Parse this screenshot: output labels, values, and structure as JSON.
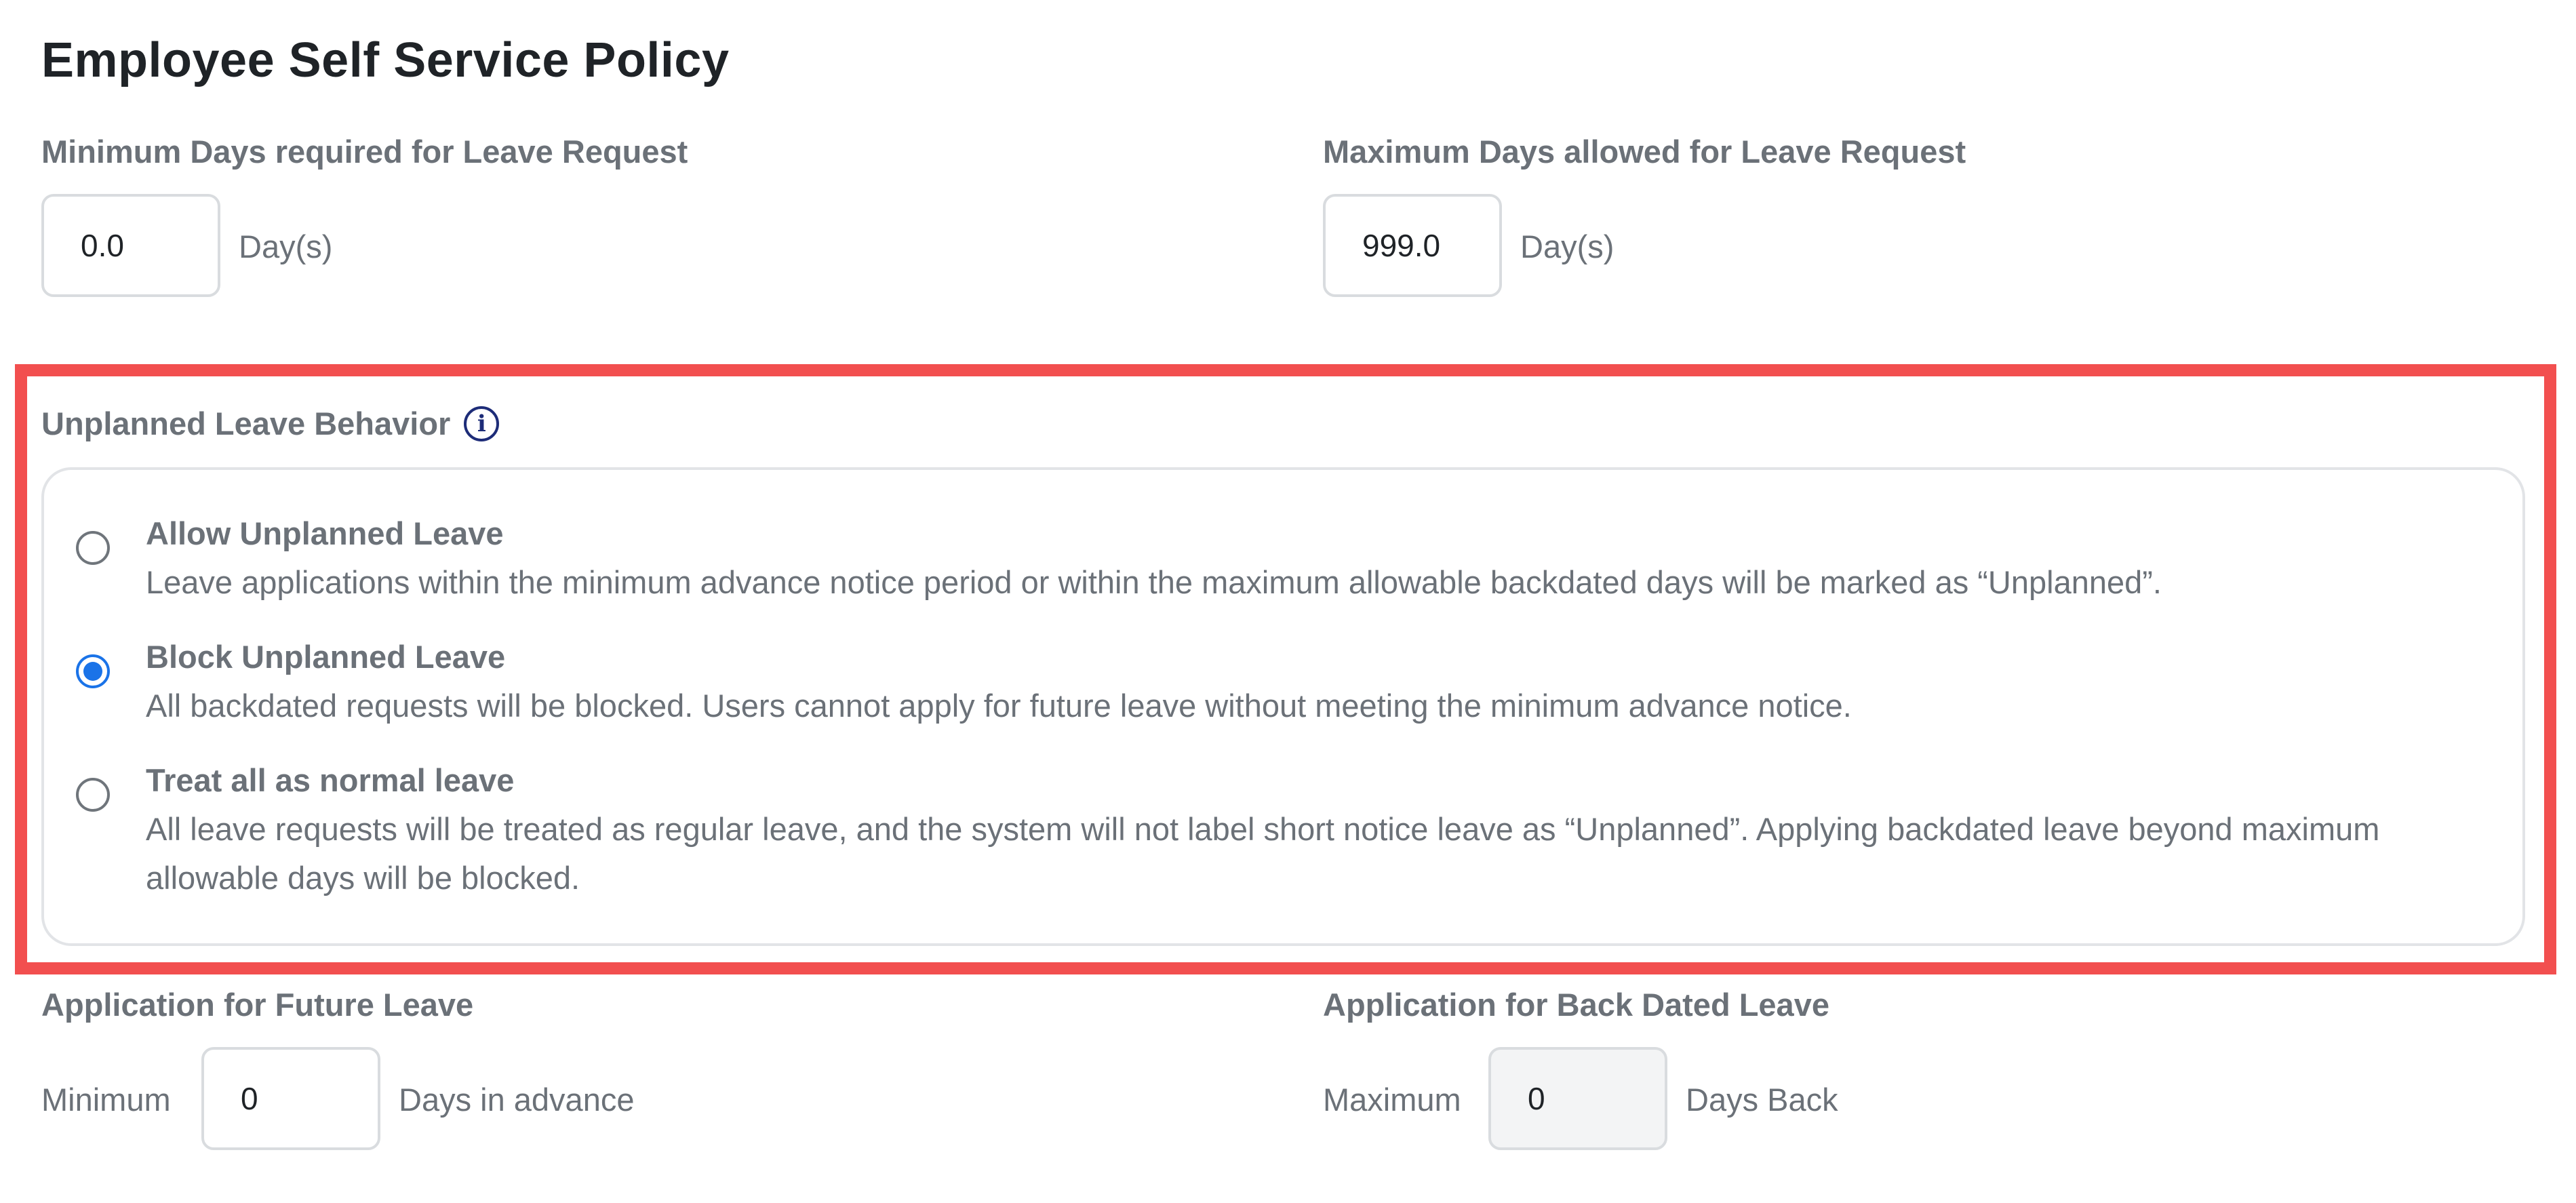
{
  "title": "Employee Self Service Policy",
  "min_days": {
    "label": "Minimum Days required for Leave Request",
    "value": "0.0",
    "unit": "Day(s)"
  },
  "max_days": {
    "label": "Maximum Days allowed for Leave Request",
    "value": "999.0",
    "unit": "Day(s)"
  },
  "unplanned": {
    "label": "Unplanned Leave Behavior",
    "info_icon": "info-icon",
    "highlight_color": "#f24f4f",
    "options": [
      {
        "title": "Allow Unplanned Leave",
        "description": "Leave applications within the minimum advance notice period or within the maximum allowable backdated days will be marked as “Unplanned”.",
        "selected": false
      },
      {
        "title": "Block Unplanned Leave",
        "description": "All backdated requests will be blocked. Users cannot apply for future leave without meeting the minimum advance notice.",
        "selected": true
      },
      {
        "title": "Treat all as normal leave",
        "description": "All leave requests will be treated as regular leave, and the system will not label short notice leave as “Unplanned”. Applying backdated leave beyond maximum allowable days will be blocked.",
        "selected": false
      }
    ]
  },
  "future_leave": {
    "label": "Application for Future Leave",
    "prefix": "Minimum",
    "value": "0",
    "unit": "Days in advance"
  },
  "back_dated": {
    "label": "Application for Back Dated Leave",
    "prefix": "Maximum",
    "value": "0",
    "unit": "Days Back"
  },
  "accent_color": "#1a73e8"
}
